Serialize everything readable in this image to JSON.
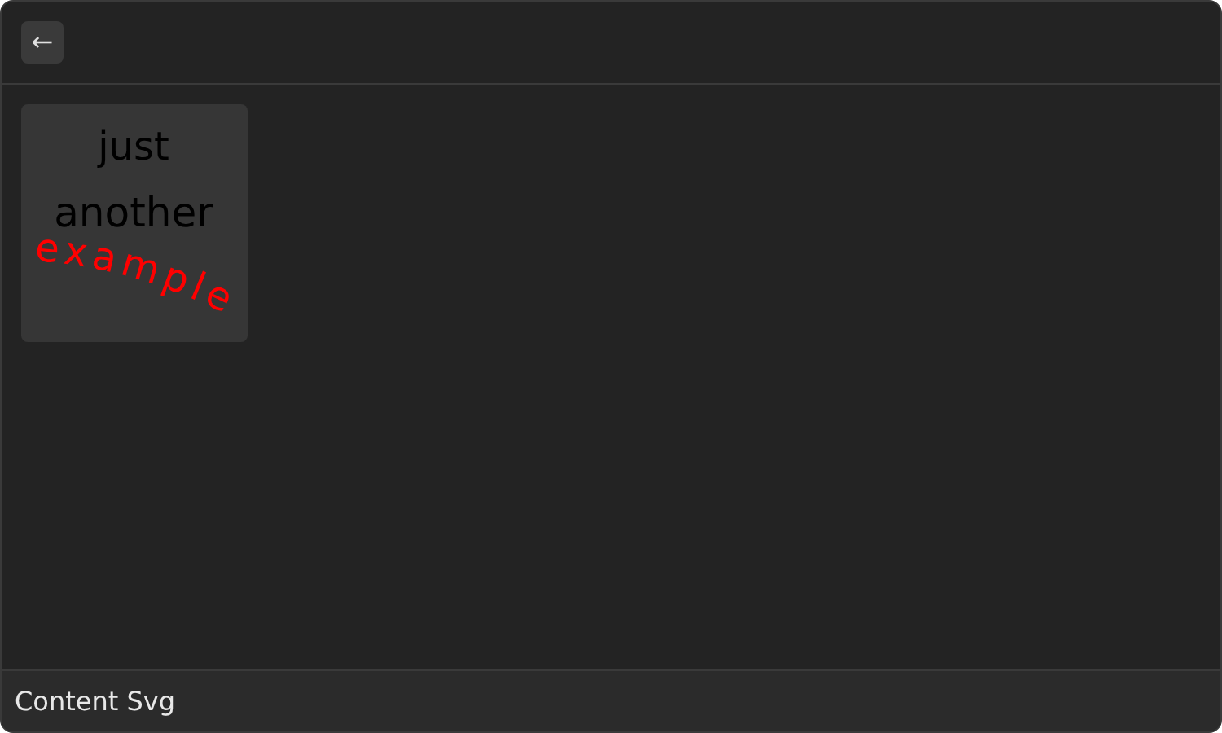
{
  "toolbar": {
    "back_button": "←"
  },
  "card": {
    "lines": [
      {
        "kind": "plain",
        "text": "just"
      },
      {
        "kind": "plain",
        "text": "another"
      },
      {
        "kind": "curved",
        "text": "example"
      }
    ]
  },
  "status_bar": {
    "title": "Content Svg"
  }
}
